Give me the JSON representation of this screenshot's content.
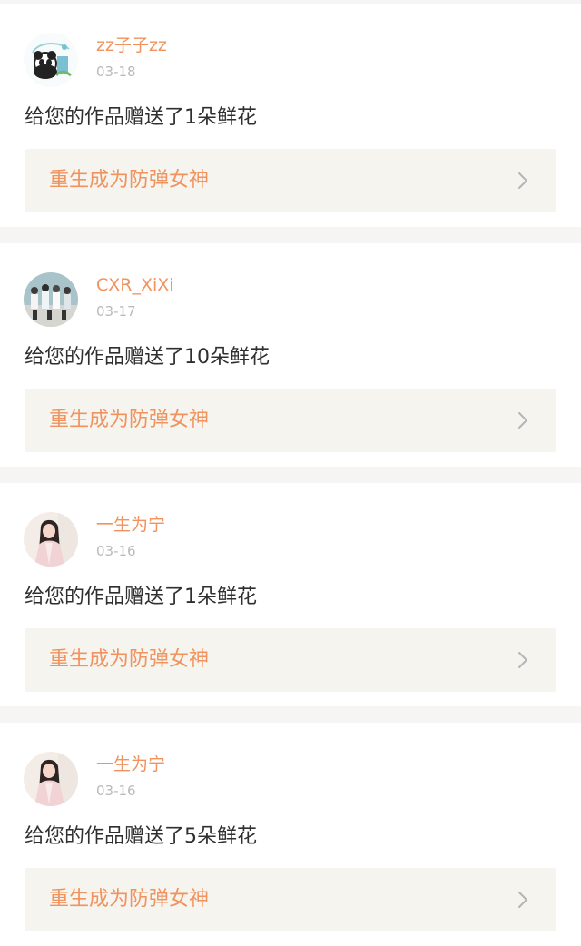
{
  "notifications": [
    {
      "user": "zz子子zz",
      "date": "03-18",
      "message": "给您的作品赠送了1朵鲜花",
      "work_title": "重生成为防弹女神",
      "avatar_icon": "panda-avatar-icon"
    },
    {
      "user": "CXR_XiXi",
      "date": "03-17",
      "message": "给您的作品赠送了10朵鲜花",
      "work_title": "重生成为防弹女神",
      "avatar_icon": "group-photo-avatar-icon"
    },
    {
      "user": "一生为宁",
      "date": "03-16",
      "message": "给您的作品赠送了1朵鲜花",
      "work_title": "重生成为防弹女神",
      "avatar_icon": "girl-portrait-avatar-icon"
    },
    {
      "user": "一生为宁",
      "date": "03-16",
      "message": "给您的作品赠送了5朵鲜花",
      "work_title": "重生成为防弹女神",
      "avatar_icon": "girl-portrait-avatar-icon"
    }
  ],
  "colors": {
    "accent": "#f0935e",
    "date": "#b9b9b9",
    "text": "#2f2f2f",
    "link_background": "#f5f4ef",
    "page_background": "#f6f5f3"
  }
}
